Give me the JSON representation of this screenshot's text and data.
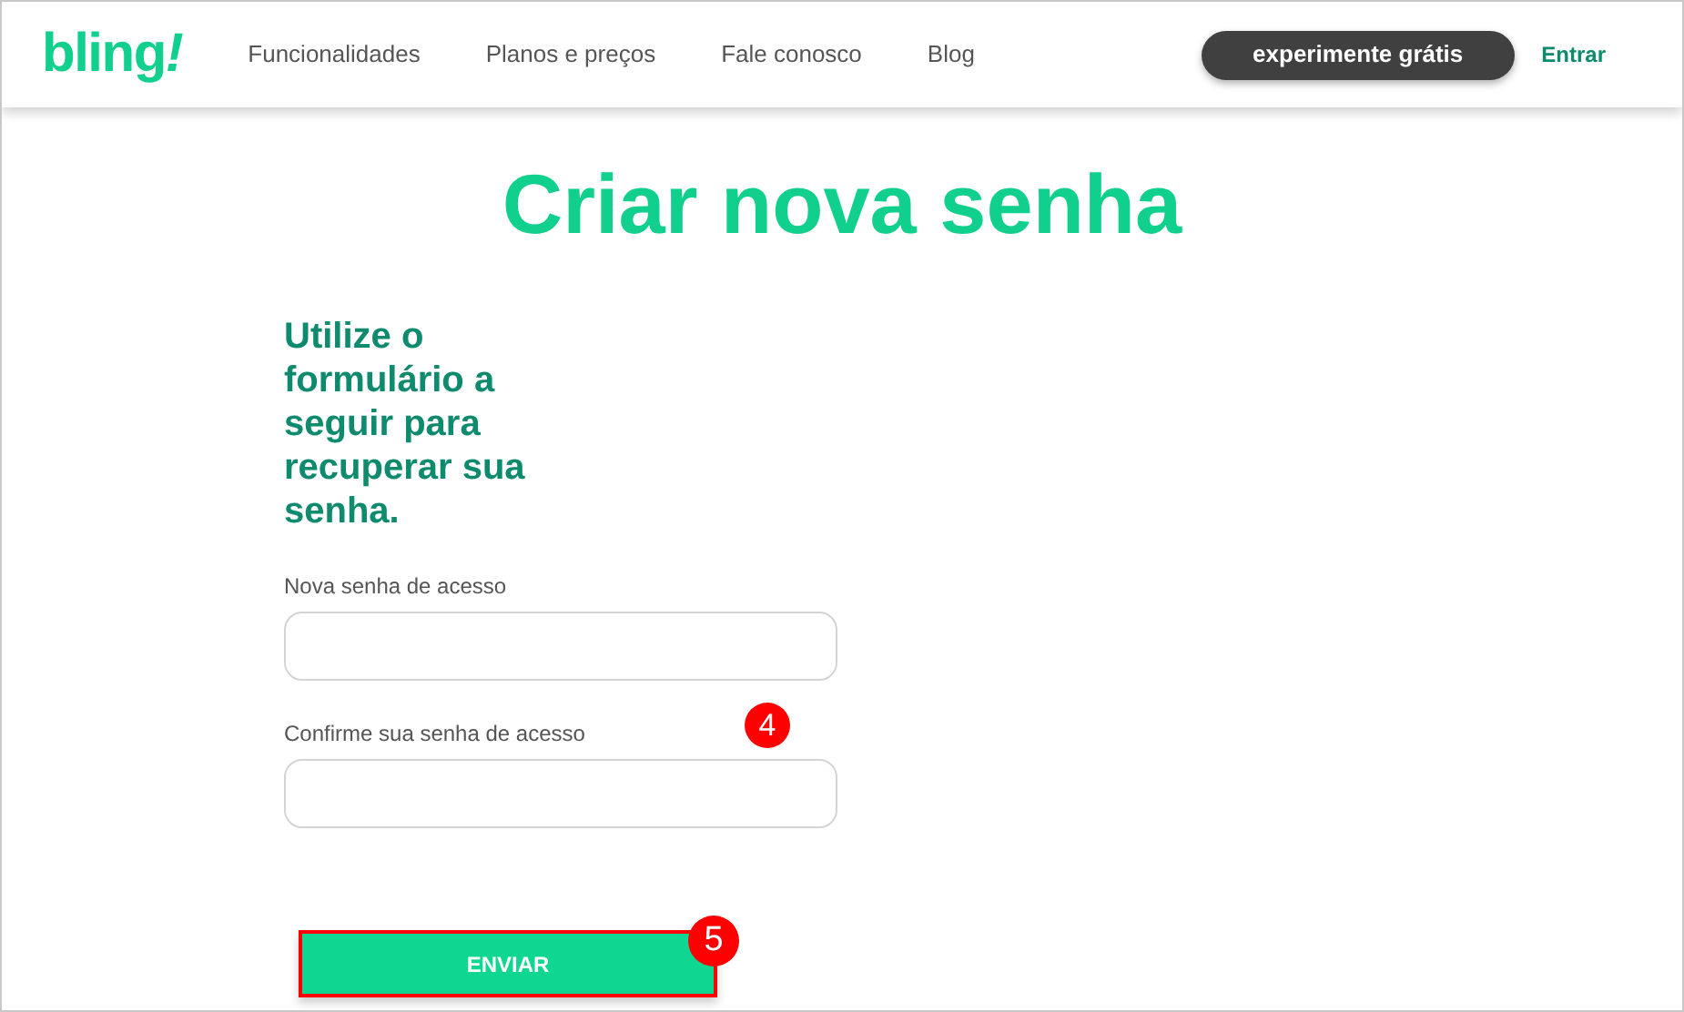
{
  "header": {
    "logo": "bling",
    "logo_mark": "!",
    "nav": [
      "Funcionalidades",
      "Planos e preços",
      "Fale conosco",
      "Blog"
    ],
    "cta": "experimente grátis",
    "login": "Entrar"
  },
  "title": "Criar nova senha",
  "subtitle": "Utilize o formulário a seguir para recuperar sua senha.",
  "fields": [
    {
      "label": "Nova senha de acesso"
    },
    {
      "label": "Confirme sua senha de acesso",
      "badge": "4"
    }
  ],
  "submit": {
    "label": "ENVIAR",
    "badge": "5",
    "highlighted": true
  }
}
